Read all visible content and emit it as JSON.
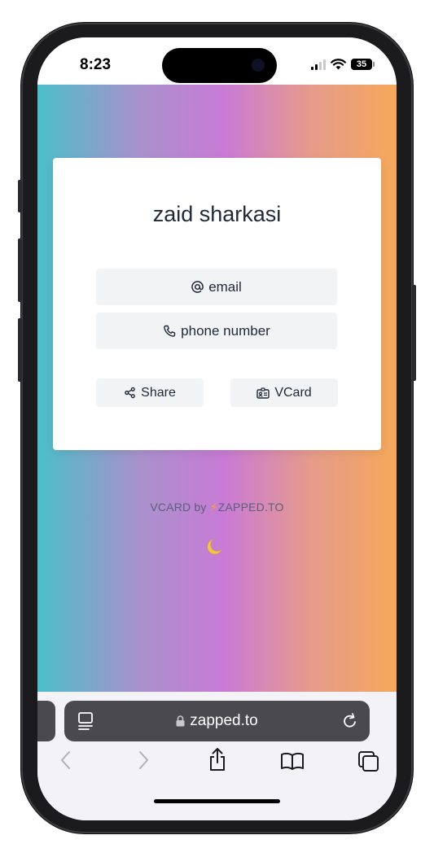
{
  "status_bar": {
    "time": "8:23",
    "battery": "35"
  },
  "theme": {
    "gradient": [
      "#4bbfca",
      "#a892cc",
      "#c97ad6",
      "#e69b8c",
      "#f6a85a"
    ],
    "bolt_color": "#f5a623",
    "url_bar_color": "#4a4a4e"
  },
  "card": {
    "name": "zaid sharkasi",
    "email_label": "email",
    "phone_label": "phone number",
    "share_label": "Share",
    "vcard_label": "VCard",
    "icons": [
      "at-icon",
      "phone-icon",
      "share-icon",
      "id-card-icon"
    ]
  },
  "footer": {
    "credit_prefix": "VCARD by",
    "credit_brand": "ZAPPED.TO",
    "icons": [
      "bolt-icon",
      "moon-icon"
    ]
  },
  "browser": {
    "url": "zapped.to",
    "toolbar_icons": [
      "back-icon",
      "forward-icon",
      "share-icon",
      "bookmarks-icon",
      "tabs-icon"
    ]
  }
}
